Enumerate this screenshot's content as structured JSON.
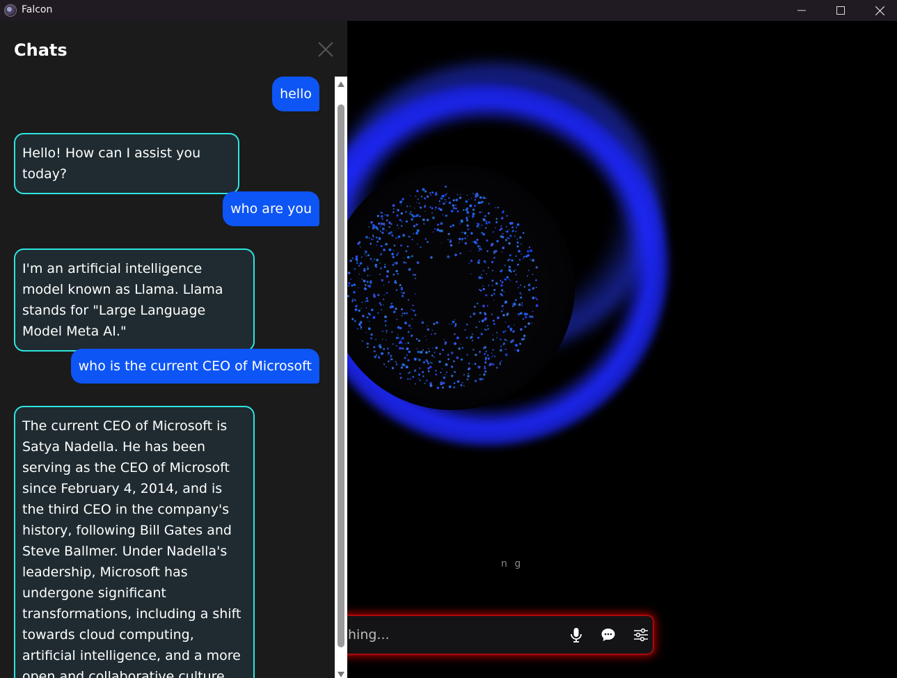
{
  "window": {
    "title": "Falcon",
    "controls": [
      "minimize",
      "maximize",
      "close"
    ]
  },
  "chat_panel": {
    "title": "Chats",
    "messages": [
      {
        "role": "user",
        "text": "hello"
      },
      {
        "role": "assistant",
        "text": "Hello! How can I assist you today?"
      },
      {
        "role": "user",
        "text": "who are you"
      },
      {
        "role": "assistant",
        "text": "I'm an artificial intelligence model known as Llama. Llama stands for \"Large Language Model Meta AI.\""
      },
      {
        "role": "user",
        "text": "who is the current CEO of Microsoft"
      },
      {
        "role": "assistant",
        "text": "The current CEO of Microsoft is Satya Nadella. He has been serving as the CEO of Microsoft since February 4, 2014, and is the third CEO in the company's history, following Bill Gates and Steve Ballmer. Under Nadella's leadership, Microsoft has undergone significant transformations, including a shift towards cloud computing, artificial intelligence, and a more open and collaborative culture."
      }
    ]
  },
  "assistant_view": {
    "status_text": "n g",
    "input_placeholder_visible": "hing...",
    "icons": [
      "microphone-icon",
      "chat-bubble-icon",
      "sliders-icon"
    ]
  },
  "colors": {
    "user_bubble": "#0d55f4",
    "assistant_border": "#2ee6e2",
    "orb_glow": "#1e28ff",
    "input_glow": "#e60000"
  }
}
